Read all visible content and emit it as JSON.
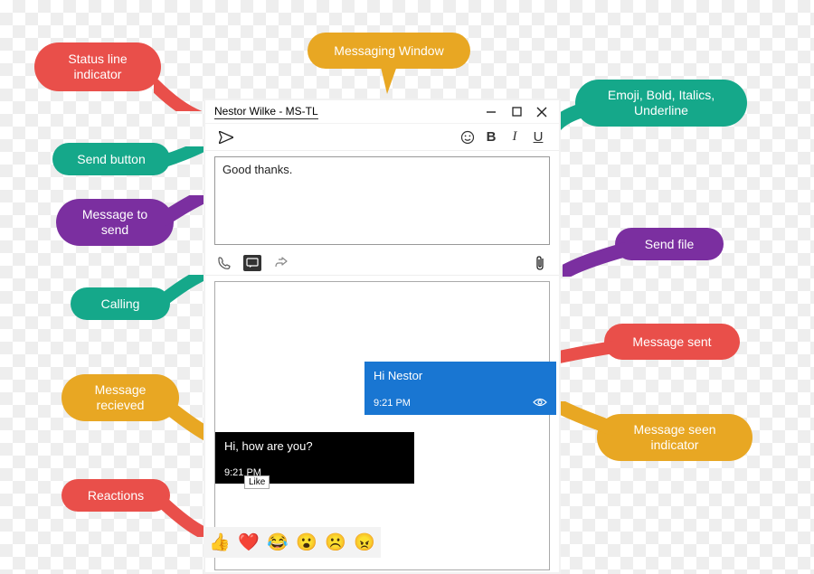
{
  "callouts": {
    "status_line": "Status line indicator",
    "messaging_window": "Messaging Window",
    "emoji_bold": "Emoji, Bold, Italics, Underline",
    "send_button": "Send button",
    "message_to_send": "Message to send",
    "send_file": "Send file",
    "calling": "Calling",
    "message_sent": "Message sent",
    "message_received": "Message recieved",
    "message_seen": "Message seen indicator",
    "reactions": "Reactions"
  },
  "window": {
    "title": "Nestor Wilke - MS-TL"
  },
  "toolbar": {
    "bold_label": "B",
    "italic_label": "I",
    "underline_label": "U"
  },
  "compose": {
    "text": "Good thanks."
  },
  "messages": {
    "sent": {
      "text": "Hi Nestor",
      "time": "9:21 PM"
    },
    "recv": {
      "text": "Hi, how are you?",
      "time": "9:21 PM"
    },
    "tooltip": "Like"
  },
  "reactions": [
    "👍",
    "❤️",
    "😂",
    "😮",
    "☹️",
    "😠"
  ]
}
